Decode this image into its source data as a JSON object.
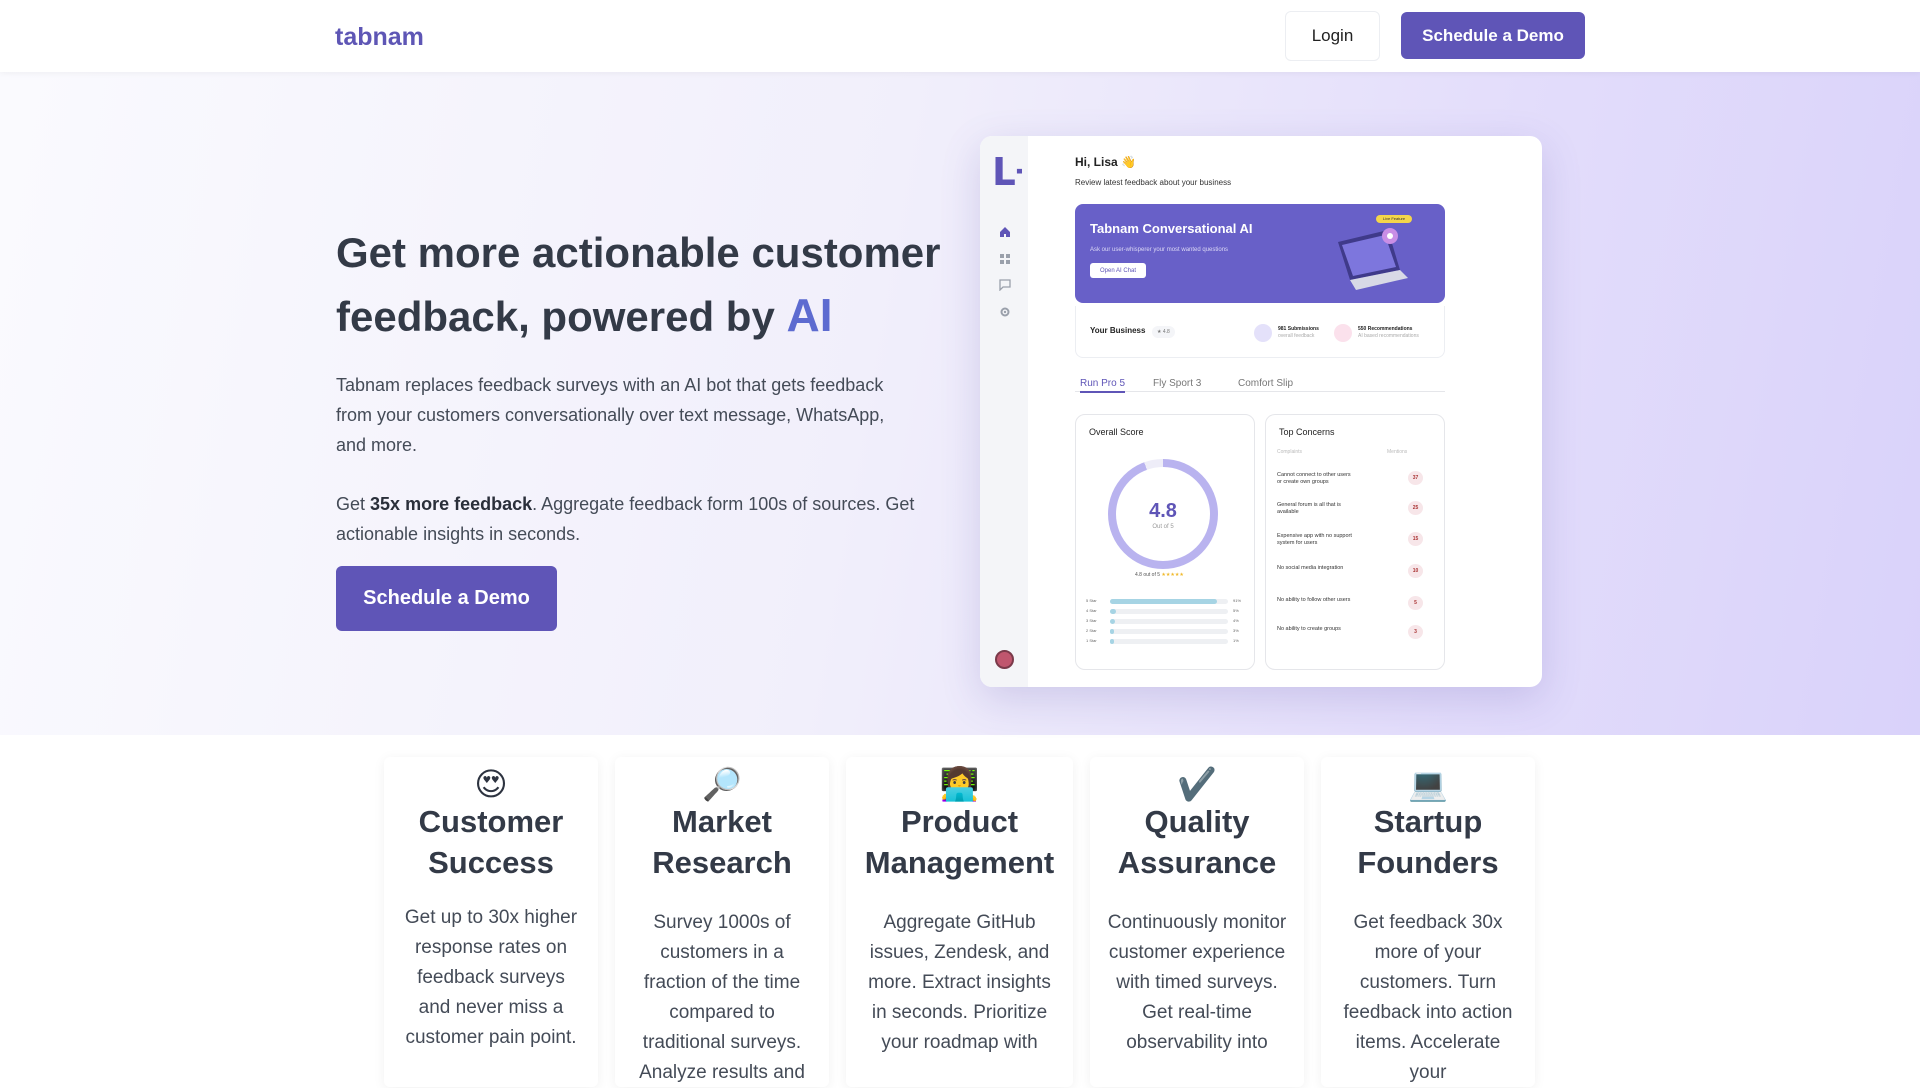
{
  "nav": {
    "logo": "tabnam",
    "login": "Login",
    "cta": "Schedule a Demo"
  },
  "hero": {
    "title": "Get more actionable customer feedback, powered by",
    "title_accent": "AI",
    "description": "Tabnam replaces feedback surveys with an AI bot that gets feedback from your customers conversationally over text message, WhatsApp, and more.",
    "p2_prefix": "Get",
    "p2_bold": "35x more feedback",
    "p2_suffix": ". Aggregate feedback form 100s of sources. Get actionable insights in seconds.",
    "cta": "Schedule a Demo"
  },
  "dashboard": {
    "greeting": "Hi, Lisa 👋",
    "subtitle": "Review latest feedback about your business",
    "banner": {
      "title": "Tabnam Conversational AI",
      "subtitle": "Ask our user-whisperer your most wanted questions",
      "button": "Open AI Chat",
      "badge": "Live Feature"
    },
    "business": {
      "label": "Your Business",
      "rating": "★ 4.8",
      "submissions": "981 Submissions",
      "submissions_sub": "overall feedback",
      "recommendations": "550 Recommendations",
      "recommendations_sub": "AI based recommendations"
    },
    "tabs": [
      "Run Pro 5",
      "Fly Sport 3",
      "Comfort Slip"
    ],
    "overall": {
      "title": "Overall Score",
      "score": "4.8",
      "out_of": "Out of 5",
      "summary": "4.8 out of 5",
      "stars": "★★★★★",
      "ratings": [
        {
          "label": "5 Star",
          "pct": "91%",
          "value": 91
        },
        {
          "label": "4 Star",
          "pct": "5%",
          "value": 5
        },
        {
          "label": "3 Star",
          "pct": "4%",
          "value": 4
        },
        {
          "label": "2 Star",
          "pct": "3%",
          "value": 3
        },
        {
          "label": "1 Star",
          "pct": "1%",
          "value": 1
        }
      ]
    },
    "concerns": {
      "title": "Top Concerns",
      "col_left": "Complaints",
      "col_right": "Mentions",
      "items": [
        {
          "text": "Cannot connect to other users or create own groups",
          "count": "37"
        },
        {
          "text": "General forum is all that is available",
          "count": "25"
        },
        {
          "text": "Expensive app with no support system for users",
          "count": "15"
        },
        {
          "text": "No social media integration",
          "count": "10"
        },
        {
          "text": "No ability to follow other users",
          "count": "5"
        },
        {
          "text": "No ability to create groups",
          "count": "3"
        }
      ]
    }
  },
  "use_cases": [
    {
      "emoji": "😍",
      "title": "Customer Success",
      "text": "Get up to 30x higher response rates on feedback surveys and never miss a customer pain point."
    },
    {
      "emoji": "🔎",
      "title": "Market Research",
      "text": "Survey 1000s of customers in a fraction of the time compared to traditional surveys. Analyze results and"
    },
    {
      "emoji": "👩‍💻",
      "title": "Product Management",
      "text": "Aggregate GitHub issues, Zendesk, and more. Extract insights in seconds. Prioritize your roadmap with"
    },
    {
      "emoji": "✔️",
      "title": "Quality Assurance",
      "text": "Continuously monitor customer experience with timed surveys. Get real-time observability into"
    },
    {
      "emoji": "💻",
      "title": "Startup Founders",
      "text": "Get feedback 30x more of your customers. Turn feedback into action items. Accelerate your"
    }
  ]
}
